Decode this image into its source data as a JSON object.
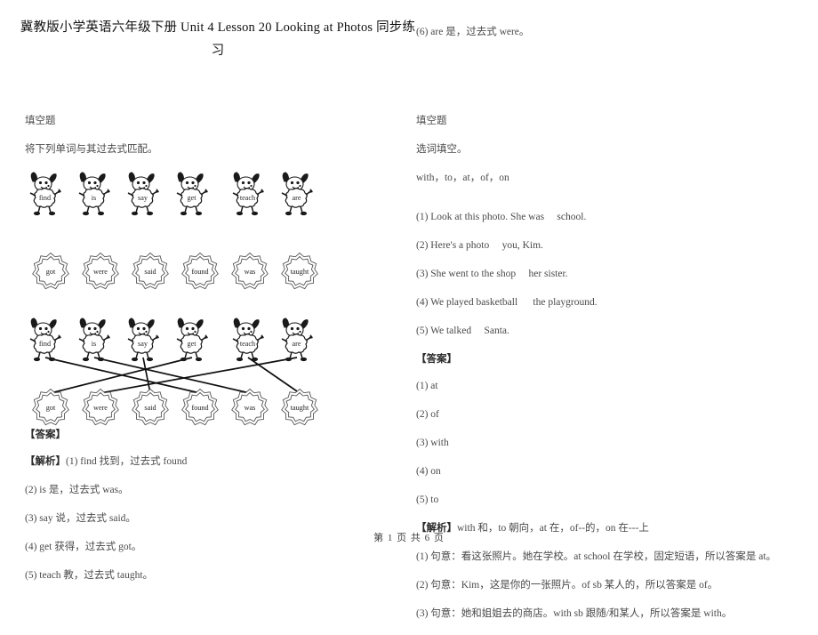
{
  "document": {
    "title": "冀教版小学英语六年级下册 Unit 4 Lesson 20 Looking at Photos  同步练习",
    "footer": "第 1 页 共 6 页"
  },
  "left_column": {
    "section_label": "填空题",
    "instruction": "将下列单词与其过去式匹配。",
    "verbs": [
      "find",
      "is",
      "say",
      "get",
      "teach",
      "are"
    ],
    "past_forms": [
      "got",
      "were",
      "said",
      "found",
      "was",
      "taught"
    ],
    "answer_label": "【答案】",
    "analysis_label": "【解析】",
    "analysis_items": [
      "【解析】(1) find 找到，过去式 found",
      "(2) is 是，过去式 was。",
      "(3) say 说，过去式 said。",
      "(4) get 获得，过去式 got。",
      "(5) teach 教，过去式 taught。"
    ],
    "matches": [
      {
        "from": "find",
        "to": "found"
      },
      {
        "from": "is",
        "to": "was"
      },
      {
        "from": "say",
        "to": "said"
      },
      {
        "from": "get",
        "to": "got"
      },
      {
        "from": "teach",
        "to": "taught"
      },
      {
        "from": "are",
        "to": "were"
      }
    ]
  },
  "right_column": {
    "carryover_item": "(6) are 是，过去式 were。",
    "section_label": "填空题",
    "instruction": "选词填空。",
    "word_bank": "with，to，at，of，on",
    "questions": [
      "(1) Look at this photo. She was     school.",
      "(2) Here's a photo     you, Kim.",
      "(3) She went to the shop     her sister.",
      "(4) We played basketball      the playground.",
      "(5) We talked     Santa."
    ],
    "answer_label": "【答案】",
    "answers": [
      "(1) at",
      "(2) of",
      "(3) with",
      "(4) on",
      "(5) to"
    ],
    "analysis_header": "【解析】with 和，to 朝向，at 在，of--的，on 在---上",
    "analysis_items": [
      "(1) 句意：看这张照片。她在学校。at school 在学校，固定短语，所以答案是 at。",
      "(2) 句意：Kim，这是你的一张照片。of sb 某人的，所以答案是 of。",
      "(3) 句意：她和姐姐去的商店。with sb 跟随/和某人，所以答案是 with。"
    ]
  },
  "layout": {
    "dog_positions_row1": [
      0,
      55,
      110,
      165,
      228,
      283
    ],
    "dog_positions_diagram": [
      0,
      55,
      110,
      165,
      228,
      283
    ],
    "badge_positions_row2": [
      6,
      62,
      118,
      174,
      230,
      286
    ],
    "badge_positions_diagram": [
      6,
      62,
      118,
      174,
      230,
      286
    ]
  }
}
